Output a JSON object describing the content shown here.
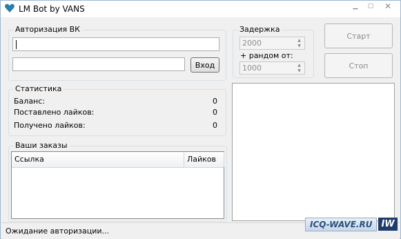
{
  "window": {
    "title": "LM Bot by VANS",
    "minimize_glyph": "▁",
    "maximize_glyph": "▢",
    "close_glyph": "✕",
    "icon": "heart-icon",
    "icon_color": "#2a7fa8"
  },
  "auth": {
    "group_title": "Авторизация ВК",
    "login_value": "",
    "password_value": "",
    "login_button": "Вход"
  },
  "delay": {
    "group_title": "Задержка",
    "delay_value": "2000",
    "random_label": "+ рандом от:",
    "random_value": "1000"
  },
  "controls": {
    "start_button": "Старт",
    "stop_button": "Стоп"
  },
  "stats": {
    "group_title": "Статистика",
    "rows": [
      {
        "label": "Баланс:",
        "value": "0"
      },
      {
        "label": "Поставлено лайков:",
        "value": "0"
      },
      {
        "label": "Получено лайков:",
        "value": "0"
      }
    ]
  },
  "orders": {
    "group_title": "Ваши заказы",
    "columns": [
      "Ссылка",
      "Лайков"
    ]
  },
  "status": {
    "text": "Ожидание авторизации..."
  },
  "watermark": {
    "site": "ICQ-WAVE.RU",
    "logo": "IW"
  }
}
